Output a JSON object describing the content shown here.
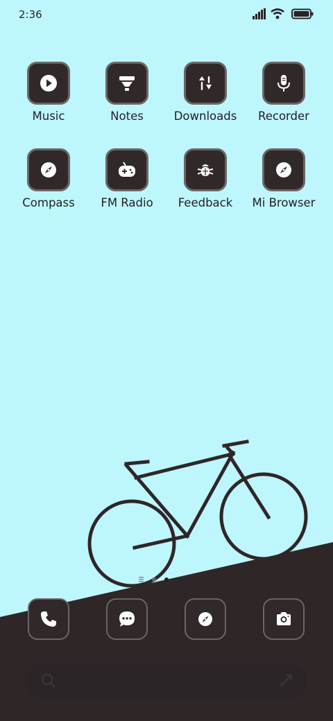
{
  "status_bar": {
    "time": "2:36",
    "icons": [
      "signal-icon",
      "wifi-icon",
      "battery-icon"
    ]
  },
  "home_apps": [
    {
      "label": "Music",
      "icon": "play-icon"
    },
    {
      "label": "Notes",
      "icon": "funnel-icon"
    },
    {
      "label": "Downloads",
      "icon": "sliders-icon"
    },
    {
      "label": "Recorder",
      "icon": "microphone-icon"
    },
    {
      "label": "Compass",
      "icon": "compass-icon"
    },
    {
      "label": "FM Radio",
      "icon": "gamepad-icon"
    },
    {
      "label": "Feedback",
      "icon": "bug-icon"
    },
    {
      "label": "Mi Browser",
      "icon": "compass-icon"
    }
  ],
  "dock": [
    {
      "icon": "phone-icon"
    },
    {
      "icon": "message-icon"
    },
    {
      "icon": "compass-icon"
    },
    {
      "icon": "camera-icon"
    }
  ],
  "page_indicator": {
    "pages": 2,
    "current": 2
  },
  "colors": {
    "sky": "#bdf7fd",
    "ground": "#2f2628",
    "tile": "#302829",
    "tile_border": "#6b6566",
    "text": "#231d1f"
  }
}
